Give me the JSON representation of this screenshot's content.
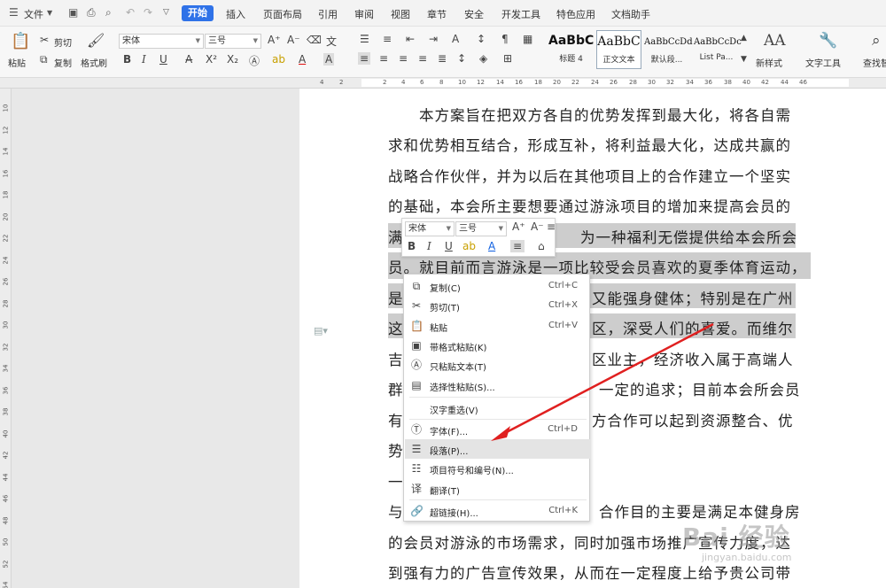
{
  "menubar": {
    "file": "文件",
    "tabs": [
      "开始",
      "插入",
      "页面布局",
      "引用",
      "审阅",
      "视图",
      "章节",
      "安全",
      "开发工具",
      "特色应用",
      "文档助手"
    ]
  },
  "ribbon": {
    "paste": "粘贴",
    "cut": "剪切",
    "copy": "复制",
    "format_painter": "格式刷",
    "font_name": "宋体",
    "font_size": "三号",
    "styles": [
      {
        "preview": "AaBbC",
        "name": "标题 4"
      },
      {
        "preview": "AaBbC",
        "name": "正文文本"
      },
      {
        "preview": "AaBbCcDd",
        "name": "默认段..."
      },
      {
        "preview": "AaBbCcDc",
        "name": "List Pa..."
      }
    ],
    "new_style": "新样式",
    "text_tools": "文字工具",
    "find_replace": "查找替"
  },
  "ruler": {
    "h_ticks": [
      "4",
      "2",
      "2",
      "4",
      "6",
      "8",
      "10",
      "12",
      "14",
      "16",
      "18",
      "20",
      "22",
      "24",
      "26",
      "28",
      "30",
      "32",
      "34",
      "36",
      "38",
      "40",
      "42",
      "44",
      "46"
    ],
    "v_ticks": [
      "10",
      "12",
      "14",
      "16",
      "18",
      "20",
      "22",
      "24",
      "26",
      "28",
      "30",
      "32",
      "34",
      "36",
      "38",
      "40",
      "42",
      "44",
      "46",
      "48",
      "50",
      "52",
      "54"
    ]
  },
  "document": {
    "lines": [
      "本方案旨在把双方各自的优势发挥到最大化，将各自需",
      "求和优势相互结合，形成互补，将利益最大化，达成共赢的",
      "战略合作伙伴，并为以后在其他项目上的合作建立一个坚实",
      "的基础，本会所主要想要通过游泳项目的增加来提高会员的",
      "满",
      "为一种福利无偿提供给本会所会",
      "员。就目前而言游泳是一项比较受会员喜欢的夏季体育运动，",
      "是",
      "又能强身健体；特别是在广州",
      "这",
      "区，深受人们的喜爱。而维尔",
      "吉",
      "区业主，经济收入属于高端人",
      "群",
      "一定的追求；目前本会所会员",
      "有",
      "方合作可以起到资源整合、优",
      "势",
      "一",
      "与",
      "合作目的主要是满足本健身房",
      "的会员对游泳的市场需求，同时加强市场推广宣传力度，达",
      "到强有力的广告宣传效果，从而在一定程度上给予贵公司带"
    ]
  },
  "mini_toolbar": {
    "font_name": "宋体",
    "font_size": "三号"
  },
  "context_menu": {
    "items": [
      {
        "label": "复制(C)",
        "shortcut": "Ctrl+C"
      },
      {
        "label": "剪切(T)",
        "shortcut": "Ctrl+X"
      },
      {
        "label": "粘贴",
        "shortcut": "Ctrl+V"
      },
      {
        "label": "带格式粘贴(K)",
        "shortcut": ""
      },
      {
        "label": "只粘贴文本(T)",
        "shortcut": ""
      },
      {
        "label": "选择性粘贴(S)...",
        "shortcut": ""
      },
      {
        "label": "汉字重选(V)",
        "shortcut": ""
      },
      {
        "label": "字体(F)...",
        "shortcut": "Ctrl+D"
      },
      {
        "label": "段落(P)...",
        "shortcut": ""
      },
      {
        "label": "项目符号和编号(N)...",
        "shortcut": ""
      },
      {
        "label": "翻译(T)",
        "shortcut": ""
      },
      {
        "label": "超链接(H)...",
        "shortcut": "Ctrl+K"
      }
    ]
  },
  "watermark": {
    "brand": "Bai 经验",
    "url": "jingyan.baidu.com"
  },
  "colors": {
    "accent": "#2f72e8",
    "selection": "#cdcdcd",
    "arrow": "#e02020"
  }
}
